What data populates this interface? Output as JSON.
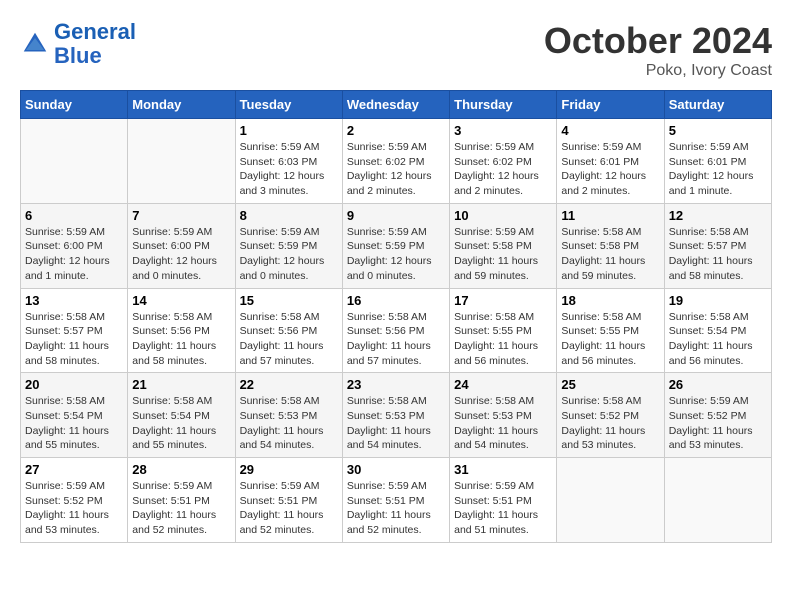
{
  "header": {
    "logo_general": "General",
    "logo_blue": "Blue",
    "month": "October 2024",
    "location": "Poko, Ivory Coast"
  },
  "days_of_week": [
    "Sunday",
    "Monday",
    "Tuesday",
    "Wednesday",
    "Thursday",
    "Friday",
    "Saturday"
  ],
  "weeks": [
    [
      {
        "day": "",
        "info": ""
      },
      {
        "day": "",
        "info": ""
      },
      {
        "day": "1",
        "info": "Sunrise: 5:59 AM\nSunset: 6:03 PM\nDaylight: 12 hours and 3 minutes."
      },
      {
        "day": "2",
        "info": "Sunrise: 5:59 AM\nSunset: 6:02 PM\nDaylight: 12 hours and 2 minutes."
      },
      {
        "day": "3",
        "info": "Sunrise: 5:59 AM\nSunset: 6:02 PM\nDaylight: 12 hours and 2 minutes."
      },
      {
        "day": "4",
        "info": "Sunrise: 5:59 AM\nSunset: 6:01 PM\nDaylight: 12 hours and 2 minutes."
      },
      {
        "day": "5",
        "info": "Sunrise: 5:59 AM\nSunset: 6:01 PM\nDaylight: 12 hours and 1 minute."
      }
    ],
    [
      {
        "day": "6",
        "info": "Sunrise: 5:59 AM\nSunset: 6:00 PM\nDaylight: 12 hours and 1 minute."
      },
      {
        "day": "7",
        "info": "Sunrise: 5:59 AM\nSunset: 6:00 PM\nDaylight: 12 hours and 0 minutes."
      },
      {
        "day": "8",
        "info": "Sunrise: 5:59 AM\nSunset: 5:59 PM\nDaylight: 12 hours and 0 minutes."
      },
      {
        "day": "9",
        "info": "Sunrise: 5:59 AM\nSunset: 5:59 PM\nDaylight: 12 hours and 0 minutes."
      },
      {
        "day": "10",
        "info": "Sunrise: 5:59 AM\nSunset: 5:58 PM\nDaylight: 11 hours and 59 minutes."
      },
      {
        "day": "11",
        "info": "Sunrise: 5:58 AM\nSunset: 5:58 PM\nDaylight: 11 hours and 59 minutes."
      },
      {
        "day": "12",
        "info": "Sunrise: 5:58 AM\nSunset: 5:57 PM\nDaylight: 11 hours and 58 minutes."
      }
    ],
    [
      {
        "day": "13",
        "info": "Sunrise: 5:58 AM\nSunset: 5:57 PM\nDaylight: 11 hours and 58 minutes."
      },
      {
        "day": "14",
        "info": "Sunrise: 5:58 AM\nSunset: 5:56 PM\nDaylight: 11 hours and 58 minutes."
      },
      {
        "day": "15",
        "info": "Sunrise: 5:58 AM\nSunset: 5:56 PM\nDaylight: 11 hours and 57 minutes."
      },
      {
        "day": "16",
        "info": "Sunrise: 5:58 AM\nSunset: 5:56 PM\nDaylight: 11 hours and 57 minutes."
      },
      {
        "day": "17",
        "info": "Sunrise: 5:58 AM\nSunset: 5:55 PM\nDaylight: 11 hours and 56 minutes."
      },
      {
        "day": "18",
        "info": "Sunrise: 5:58 AM\nSunset: 5:55 PM\nDaylight: 11 hours and 56 minutes."
      },
      {
        "day": "19",
        "info": "Sunrise: 5:58 AM\nSunset: 5:54 PM\nDaylight: 11 hours and 56 minutes."
      }
    ],
    [
      {
        "day": "20",
        "info": "Sunrise: 5:58 AM\nSunset: 5:54 PM\nDaylight: 11 hours and 55 minutes."
      },
      {
        "day": "21",
        "info": "Sunrise: 5:58 AM\nSunset: 5:54 PM\nDaylight: 11 hours and 55 minutes."
      },
      {
        "day": "22",
        "info": "Sunrise: 5:58 AM\nSunset: 5:53 PM\nDaylight: 11 hours and 54 minutes."
      },
      {
        "day": "23",
        "info": "Sunrise: 5:58 AM\nSunset: 5:53 PM\nDaylight: 11 hours and 54 minutes."
      },
      {
        "day": "24",
        "info": "Sunrise: 5:58 AM\nSunset: 5:53 PM\nDaylight: 11 hours and 54 minutes."
      },
      {
        "day": "25",
        "info": "Sunrise: 5:58 AM\nSunset: 5:52 PM\nDaylight: 11 hours and 53 minutes."
      },
      {
        "day": "26",
        "info": "Sunrise: 5:59 AM\nSunset: 5:52 PM\nDaylight: 11 hours and 53 minutes."
      }
    ],
    [
      {
        "day": "27",
        "info": "Sunrise: 5:59 AM\nSunset: 5:52 PM\nDaylight: 11 hours and 53 minutes."
      },
      {
        "day": "28",
        "info": "Sunrise: 5:59 AM\nSunset: 5:51 PM\nDaylight: 11 hours and 52 minutes."
      },
      {
        "day": "29",
        "info": "Sunrise: 5:59 AM\nSunset: 5:51 PM\nDaylight: 11 hours and 52 minutes."
      },
      {
        "day": "30",
        "info": "Sunrise: 5:59 AM\nSunset: 5:51 PM\nDaylight: 11 hours and 52 minutes."
      },
      {
        "day": "31",
        "info": "Sunrise: 5:59 AM\nSunset: 5:51 PM\nDaylight: 11 hours and 51 minutes."
      },
      {
        "day": "",
        "info": ""
      },
      {
        "day": "",
        "info": ""
      }
    ]
  ]
}
